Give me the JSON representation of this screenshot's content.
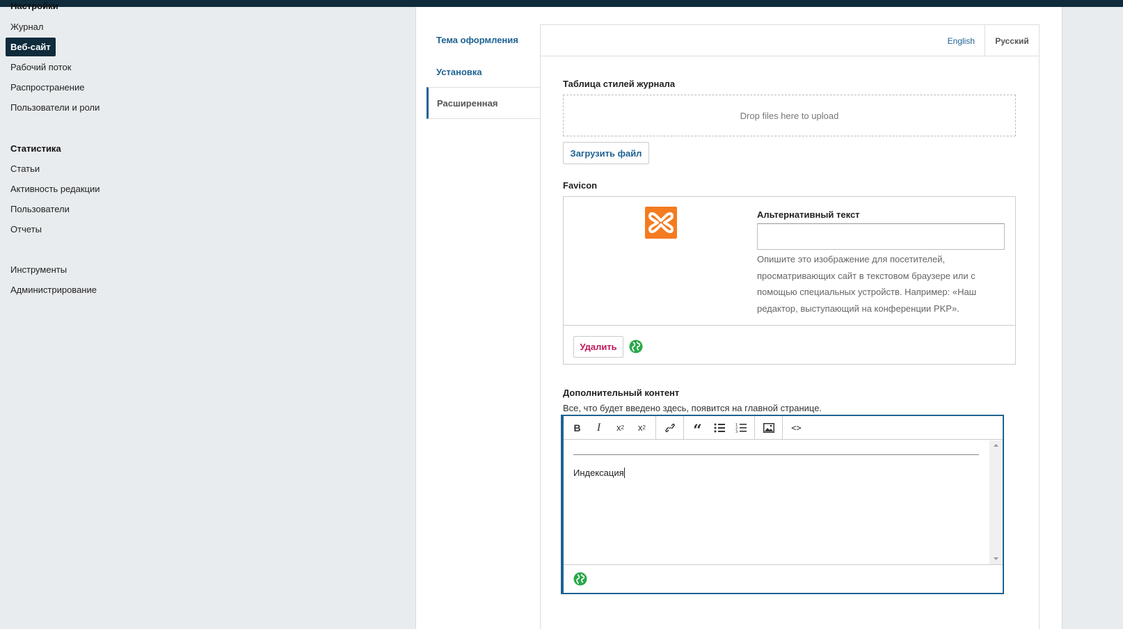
{
  "nav": {
    "settings_heading": "Настройки",
    "settings_items": [
      "Журнал",
      "Веб-сайт",
      "Рабочий поток",
      "Распространение",
      "Пользователи и роли"
    ],
    "stats_heading": "Статистика",
    "stats_items": [
      "Статьи",
      "Активность редакции",
      "Пользователи",
      "Отчеты"
    ],
    "tools": "Инструменты",
    "admin": "Администрирование"
  },
  "tabs": [
    "Тема оформления",
    "Установка",
    "Расширенная"
  ],
  "locales": {
    "en": "English",
    "ru": "Русский"
  },
  "stylesheet": {
    "label": "Таблица стилей журнала",
    "dropzone": "Drop files here to upload",
    "upload_button": "Загрузить файл"
  },
  "favicon": {
    "label": "Favicon",
    "alt_label": "Альтернативный текст",
    "alt_value": "",
    "alt_description": "Опишите это изображение для посетителей, просматривающих сайт в текстовом браузере или с помощью специальных устройств. Например: «Наш редактор, выступающий на конференции PKP».",
    "delete_button": "Удалить"
  },
  "additional": {
    "label": "Дополнительный контент",
    "description": "Все, что будет введено здесь, появится на главной странице.",
    "editor_text": "Индексация"
  },
  "colors": {
    "accent": "#1e6292",
    "nav_dark": "#0f2b3c",
    "danger": "#c2185b",
    "favicon_orange": "#f47b20",
    "globe_green": "#2aa84a"
  },
  "toolbar_icons": [
    "bold-icon",
    "italic-icon",
    "superscript-icon",
    "subscript-icon",
    "link-icon",
    "blockquote-icon",
    "bullet-list-icon",
    "numbered-list-icon",
    "image-icon",
    "code-icon"
  ]
}
